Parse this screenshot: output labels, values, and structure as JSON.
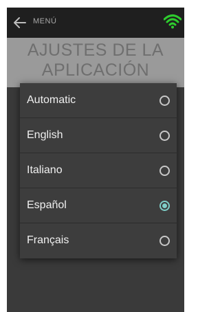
{
  "topbar": {
    "back_icon": "arrow-left-icon",
    "menu_label": "MENÚ",
    "wifi_icon": "wifi-icon",
    "wifi_color": "#2ecc2e"
  },
  "page": {
    "title_line1": "AJUSTES DE LA",
    "title_line2": "APLICACIÓN"
  },
  "dialog": {
    "options": [
      {
        "label": "Automatic",
        "selected": false
      },
      {
        "label": "English",
        "selected": false
      },
      {
        "label": "Italiano",
        "selected": false
      },
      {
        "label": "Español",
        "selected": true
      },
      {
        "label": "Français",
        "selected": false
      }
    ],
    "accent_color": "#7fcfc8"
  }
}
